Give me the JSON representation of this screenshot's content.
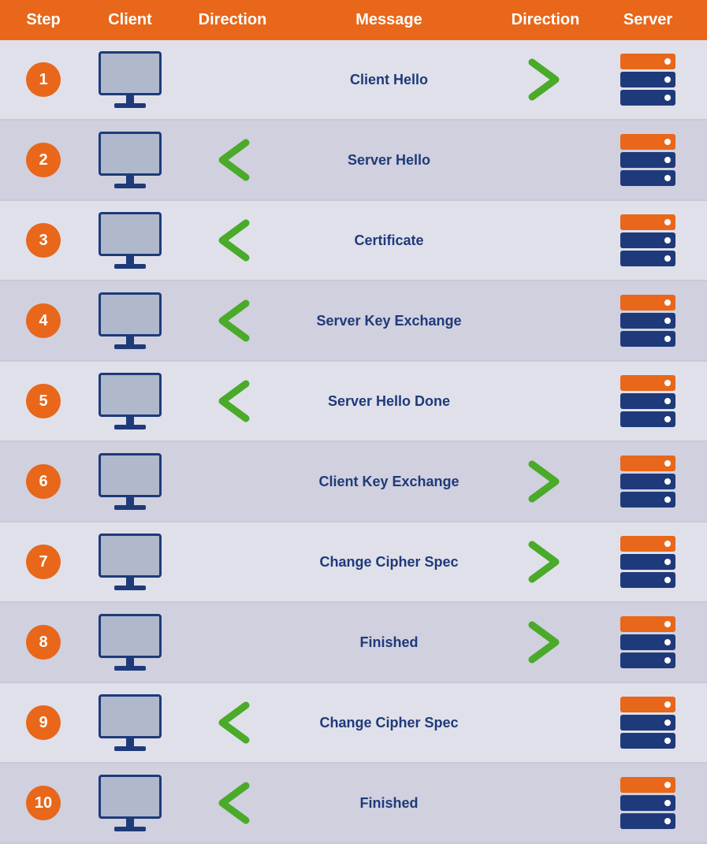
{
  "header": {
    "cols": [
      "Step",
      "Client",
      "Direction",
      "Message",
      "Direction",
      "Server"
    ]
  },
  "rows": [
    {
      "step": "1",
      "message": "Client Hello",
      "dir_left": false,
      "dir_right": true
    },
    {
      "step": "2",
      "message": "Server Hello",
      "dir_left": true,
      "dir_right": false
    },
    {
      "step": "3",
      "message": "Certificate",
      "dir_left": true,
      "dir_right": false
    },
    {
      "step": "4",
      "message": "Server Key Exchange",
      "dir_left": true,
      "dir_right": false
    },
    {
      "step": "5",
      "message": "Server Hello Done",
      "dir_left": true,
      "dir_right": false
    },
    {
      "step": "6",
      "message": "Client Key Exchange",
      "dir_left": false,
      "dir_right": true
    },
    {
      "step": "7",
      "message": "Change Cipher Spec",
      "dir_left": false,
      "dir_right": true
    },
    {
      "step": "8",
      "message": "Finished",
      "dir_left": false,
      "dir_right": true
    },
    {
      "step": "9",
      "message": "Change Cipher Spec",
      "dir_left": true,
      "dir_right": false
    },
    {
      "step": "10",
      "message": "Finished",
      "dir_left": true,
      "dir_right": false
    }
  ]
}
